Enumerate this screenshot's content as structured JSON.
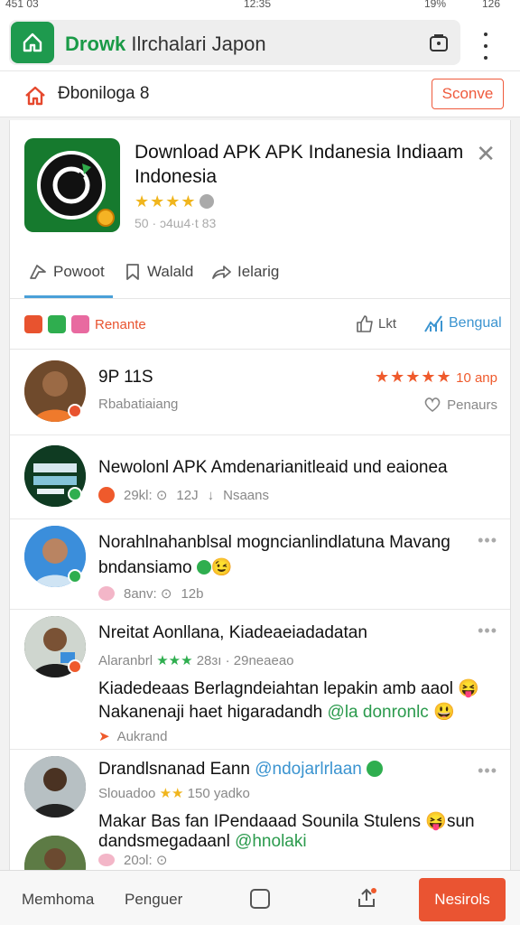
{
  "statusbar": {
    "left": "451 03",
    "center": "12:35",
    "battery": "19%",
    "right": "126"
  },
  "urlbar": {
    "site_name": "Drowk",
    "url_rest": "Ilrchalari Japon"
  },
  "header": {
    "site_label": "Ɖboniloga 8",
    "signup_label": "Sconve"
  },
  "app": {
    "title": "Download APK APK Indanesia Indiaam Indonesia",
    "stars": "★★★★",
    "meta": "50 · ɔ4ɯ4·t 83"
  },
  "tabs": [
    {
      "label": "Powoot"
    },
    {
      "label": "Walald"
    },
    {
      "label": "Ielarig"
    }
  ],
  "actions": {
    "left_label": "Renante",
    "like_label": "Lkt",
    "share_label": "Bengual"
  },
  "top_user": {
    "name": "9P 11S",
    "subtitle": "Rbabatiaiang",
    "stars": "★★★★★",
    "rating_text": "10 anp",
    "follow_label": "Penaurs"
  },
  "posts": [
    {
      "title": "Newolonl APK Amdenarianitleaid und eaionea",
      "meta1": "29kl: ⊙",
      "meta2": "12J",
      "meta3": "Nsaans"
    },
    {
      "title": "Norahlnahanblsal mogncianlindlatuna Mavang",
      "title2": "bndansiamo",
      "emoji": "😉",
      "meta1": "8anv: ⊙",
      "meta2": "12b"
    },
    {
      "title": "Nreitat Aonllana, Kiadeaeiadadatan",
      "sub_name": "Alaranbrl",
      "sub_stars": "★★★",
      "sub_meta": "28ɜı · 29neaeao",
      "body1": "Kiadedeaas Berlagndeiahtan lepakin amb aaol",
      "body2_a": "Nakanenaji haet higaradandh",
      "body2_link": "@la donronlc",
      "action": "Aukrand"
    },
    {
      "title": "Drandlsnanad Eann",
      "title_link": "@ndojarlrlaan",
      "sub_name": "Slouadoo",
      "sub_stars": "★★",
      "sub_meta": "150 yadko",
      "body1": "Makar Bas fan IPendaaad Sounila Stulens",
      "body1_end": "sun",
      "body2_a": "dandsmegadaanl",
      "body2_link": "@hnolaki",
      "meta1": "20ɔl: ⊙"
    }
  ],
  "bottomnav": {
    "item1": "Memhoma",
    "item2": "Penguer",
    "replies_label": "Nesirols"
  },
  "colors": {
    "accent_green": "#1e9a4e",
    "accent_orange": "#ea5432",
    "link_blue": "#3b94d0"
  }
}
